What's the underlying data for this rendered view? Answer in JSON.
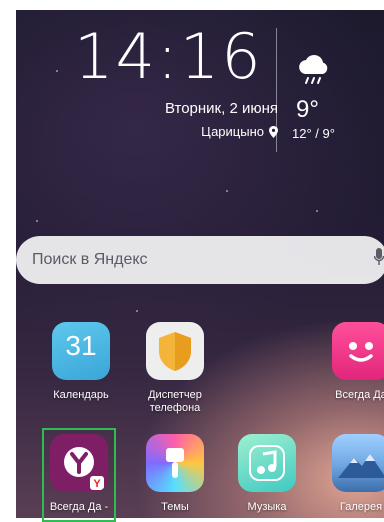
{
  "clock": {
    "time": "14:16",
    "date": "Вторник, 2 июня",
    "location": "Царицыно"
  },
  "weather": {
    "temp": "9°",
    "range": "12° / 9°",
    "icon": "rain-cloud-icon"
  },
  "search": {
    "placeholder": "Поиск в Яндекс",
    "mic_icon": "microphone-icon"
  },
  "apps": {
    "calendar": {
      "label": "Календарь",
      "day": "31"
    },
    "phone_manager": {
      "label": "Диспетчер телефона"
    },
    "always_yes_alice": {
      "label": "Всегда Да"
    },
    "always_yes_yandex": {
      "label": "Всегда Да -"
    },
    "themes": {
      "label": "Темы"
    },
    "music": {
      "label": "Музыка"
    },
    "gallery": {
      "label": "Галерея"
    }
  },
  "colors": {
    "highlight": "#2cbe4e",
    "search_bg": "#ffffff"
  }
}
